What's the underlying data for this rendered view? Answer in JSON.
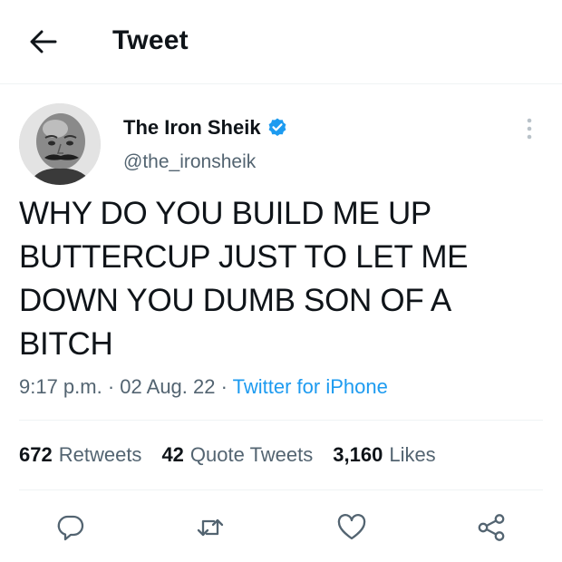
{
  "header": {
    "title": "Tweet",
    "back_icon": "arrow-left-icon"
  },
  "author": {
    "display_name": "The Iron Sheik",
    "handle": "@the_ironsheik",
    "verified": true,
    "verified_color": "#1d9bf0"
  },
  "tweet": {
    "lines": [
      "WHY DO YOU BUILD ME UP",
      "BUTTERCUP JUST TO LET ME",
      "DOWN YOU DUMB SON OF A",
      "BITCH"
    ],
    "time": "9:17 p.m.",
    "separator": " · ",
    "date": "02 Aug. 22",
    "source": "Twitter for iPhone"
  },
  "stats": {
    "retweets_count": "672",
    "retweets_label": "Retweets",
    "quotes_count": "42",
    "quotes_label": "Quote Tweets",
    "likes_count": "3,160",
    "likes_label": "Likes"
  },
  "actions": [
    {
      "name": "reply-icon"
    },
    {
      "name": "retweet-icon"
    },
    {
      "name": "like-icon"
    },
    {
      "name": "share-icon"
    }
  ],
  "colors": {
    "text": "#0f1419",
    "secondary": "#536471",
    "accent": "#1d9bf0",
    "divider": "#eff3f4"
  }
}
